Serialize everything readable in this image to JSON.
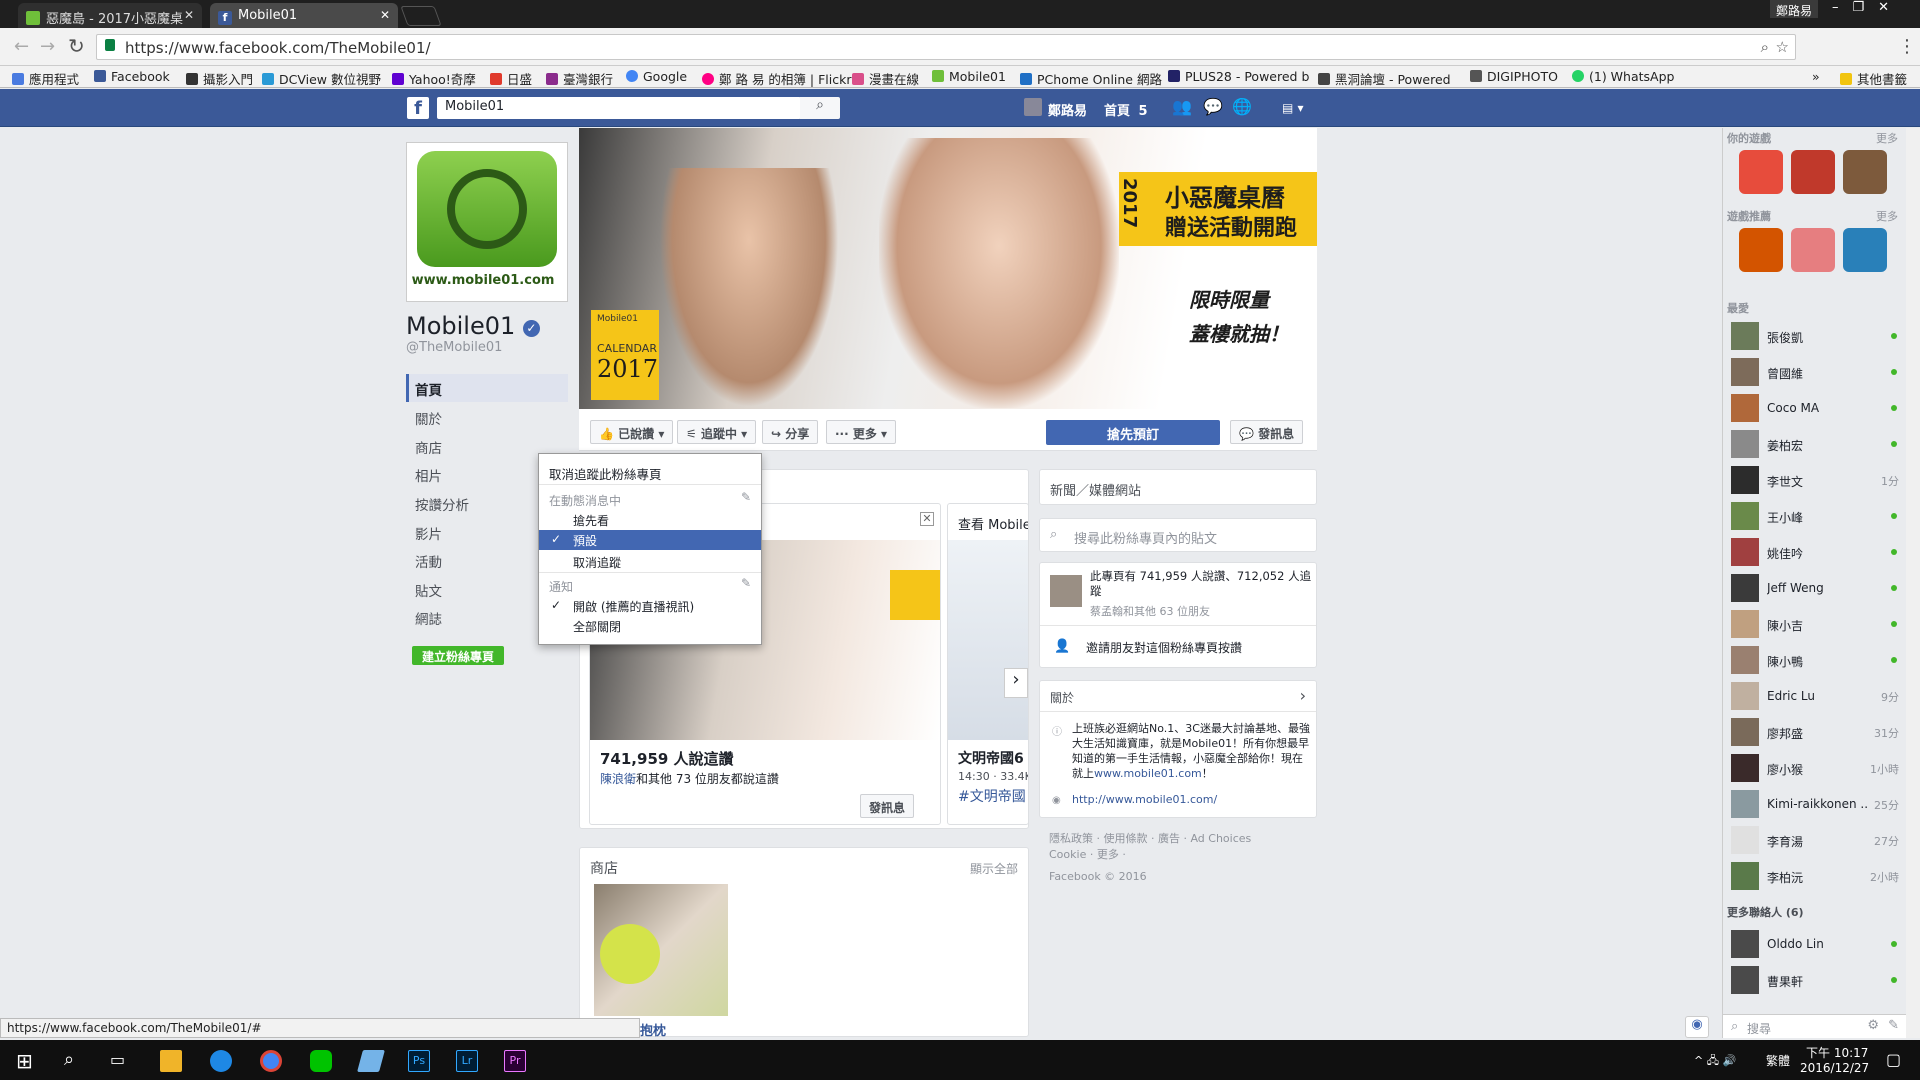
{
  "browser": {
    "tabs": [
      {
        "label": "惡魔島 - 2017小惡魔桌"
      },
      {
        "label": "Mobile01"
      }
    ],
    "url": "https://www.facebook.com/TheMobile01/",
    "bookmarks": [
      "應用程式",
      "Facebook",
      "攝影入門",
      "DCView 數位視野",
      "Yahoo!奇摩",
      "日盛",
      "臺灣銀行",
      "Google",
      "鄭 路 易 的相簿 | Flickr",
      "漫畫在線",
      "Mobile01",
      "PChome Online 網路",
      "PLUS28 - Powered b",
      "黑洞論壇 - Powered",
      "DIGIPHOTO",
      "(1) WhatsApp"
    ],
    "bookmarks_more": "其他書籤",
    "user": "鄭路易",
    "status_url": "https://www.facebook.com/TheMobile01/#"
  },
  "fb": {
    "search_value": "Mobile01",
    "nav_user": "鄭路易",
    "nav_home": "首頁",
    "nav_home_count": "5"
  },
  "page": {
    "name": "Mobile01",
    "handle": "@TheMobile01",
    "logo_text": "www.mobile01.com",
    "left_nav": [
      "首頁",
      "關於",
      "商店",
      "相片",
      "按讚分析",
      "影片",
      "活動",
      "貼文",
      "網誌"
    ],
    "create_page": "建立粉絲專頁",
    "cover": {
      "title_line1": "小惡魔桌曆",
      "title_line2": "贈送活動開跑",
      "year_vertical": "2017",
      "slogan1": "限時限量",
      "slogan2": "蓋樓就抽！",
      "cal_brand": "Mobile01",
      "cal_label": "CALENDAR",
      "cal_year": "2017"
    },
    "actions": {
      "liked": "已說讚",
      "following": "追蹤中",
      "share": "分享",
      "more": "更多",
      "book": "搶先預訂",
      "message": "發訊息"
    }
  },
  "dropdown": {
    "unfollow_page": "取消追蹤此粉絲專頁",
    "in_news_feed": "在動態消息中",
    "see_first": "搶先看",
    "default": "預設",
    "unfollow": "取消追蹤",
    "notifications": "通知",
    "on": "開啟 (推薦的直播視訊)",
    "all_off": "全部關閉"
  },
  "feed": {
    "post_likes": "741,959 人說這讚",
    "post_friends_name": "陳浪衛",
    "post_friends_rest": "和其他 73 位朋友都說這讚",
    "post_msg_btn": "發訊息",
    "second_card_title": "查看 Mobile",
    "second_card_body": "文明帝國6",
    "second_card_meta": "14:30 · 33.4K",
    "second_card_tag": "#文明帝國",
    "shop_title": "商店",
    "shop_all": "顯示全部",
    "shop_item": "抱枕"
  },
  "sidecol": {
    "category": "新聞／媒體網站",
    "search_placeholder": "搜尋此粉絲專頁內的貼文",
    "likes_text": "此專頁有 741,959 人說讚、712,052 人追蹤",
    "likes_friends": "蔡孟翰和其他 63 位朋友",
    "invite": "邀請朋友對這個粉絲專頁按讚",
    "about_title": "關於",
    "about_text": "上班族必逛網站No.1、3C迷最大討論基地、最強大生活知識寶庫，就是Mobile01！所有你想最早知道的第一手生活情報，小惡魔全部給你！現在就上",
    "about_link_inline": "www.mobile01.com",
    "about_text_end": "！",
    "website": "http://www.mobile01.com/",
    "footer1": "隱私政策 · 使用條款 · 廣告 · Ad Choices",
    "footer2": "Cookie · 更多 ·",
    "footer3": "Facebook © 2016"
  },
  "rightbar": {
    "your_games": "你的遊戲",
    "more1": "更多",
    "game_recs": "遊戲推薦",
    "more2": "更多",
    "favorites": "最愛",
    "friends": [
      {
        "name": "張俊凱",
        "status": ""
      },
      {
        "name": "曾國維",
        "status": ""
      },
      {
        "name": "Coco MA",
        "status": ""
      },
      {
        "name": "姜柏宏",
        "status": ""
      },
      {
        "name": "李世文",
        "status": "1分"
      },
      {
        "name": "王小峰",
        "status": ""
      },
      {
        "name": "姚佳吟",
        "status": ""
      },
      {
        "name": "Jeff Weng",
        "status": ""
      },
      {
        "name": "陳小吉",
        "status": ""
      },
      {
        "name": "陳小鴨",
        "status": ""
      },
      {
        "name": "Edric Lu",
        "status": "9分"
      },
      {
        "name": "廖邦盛",
        "status": "31分"
      },
      {
        "name": "廖小猴",
        "status": "1小時"
      },
      {
        "name": "Kimi-raikkonen ...",
        "status": "25分"
      },
      {
        "name": "李育湯",
        "status": "27分"
      },
      {
        "name": "李柏沅",
        "status": "2小時"
      }
    ],
    "more_contacts": "更多聯絡人 (6)",
    "more_friends": [
      {
        "name": "Olddo Lin",
        "status": ""
      },
      {
        "name": "曹果軒",
        "status": ""
      }
    ],
    "search": "搜尋"
  },
  "taskbar": {
    "time": "下午 10:17",
    "date": "2016/12/27",
    "ime": "繁體"
  }
}
